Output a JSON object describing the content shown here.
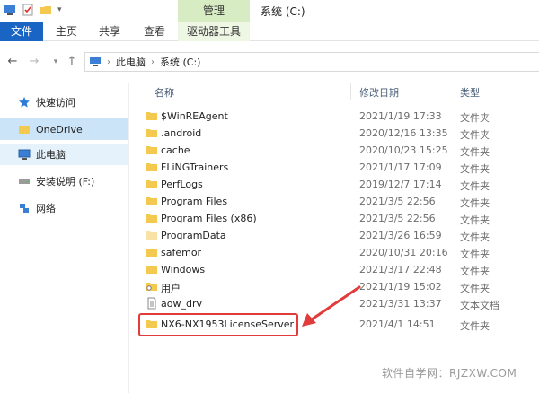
{
  "title_bar": {
    "tool_tab": "管理",
    "window_title": "系统 (C:)"
  },
  "ribbon": {
    "file": "文件",
    "home": "主页",
    "share": "共享",
    "view": "查看",
    "drive_tools": "驱动器工具"
  },
  "address": {
    "path": [
      "此电脑",
      "系统 (C:)"
    ]
  },
  "nav_pane": [
    {
      "label": "快速访问",
      "icon": "star-icon"
    },
    {
      "label": "OneDrive",
      "icon": "cloud-icon"
    },
    {
      "label": "此电脑",
      "icon": "computer-icon"
    },
    {
      "label": "安装说明 (F:)",
      "icon": "drive-icon"
    },
    {
      "label": "网络",
      "icon": "network-icon"
    }
  ],
  "columns": {
    "name": "名称",
    "date": "修改日期",
    "type": "类型"
  },
  "files": [
    {
      "name": "$WinREAgent",
      "date": "2021/1/19 17:33",
      "type": "文件夹",
      "icon": "folder-icon"
    },
    {
      "name": ".android",
      "date": "2020/12/16 13:35",
      "type": "文件夹",
      "icon": "folder-icon"
    },
    {
      "name": "cache",
      "date": "2020/10/23 15:25",
      "type": "文件夹",
      "icon": "folder-icon"
    },
    {
      "name": "FLiNGTrainers",
      "date": "2021/1/17 17:09",
      "type": "文件夹",
      "icon": "folder-icon"
    },
    {
      "name": "PerfLogs",
      "date": "2019/12/7 17:14",
      "type": "文件夹",
      "icon": "folder-icon"
    },
    {
      "name": "Program Files",
      "date": "2021/3/5 22:56",
      "type": "文件夹",
      "icon": "folder-icon"
    },
    {
      "name": "Program Files (x86)",
      "date": "2021/3/5 22:56",
      "type": "文件夹",
      "icon": "folder-icon"
    },
    {
      "name": "ProgramData",
      "date": "2021/3/26 16:59",
      "type": "文件夹",
      "icon": "folder-light-icon"
    },
    {
      "name": "safemor",
      "date": "2020/10/31 20:16",
      "type": "文件夹",
      "icon": "folder-icon"
    },
    {
      "name": "Windows",
      "date": "2021/3/17 22:48",
      "type": "文件夹",
      "icon": "folder-icon"
    },
    {
      "name": "用户",
      "date": "2021/1/19 15:02",
      "type": "文件夹",
      "icon": "user-folder-icon"
    },
    {
      "name": "aow_drv",
      "date": "2021/3/31 13:37",
      "type": "文本文档",
      "icon": "text-file-icon"
    },
    {
      "name": "NX6-NX1953LicenseServer",
      "date": "2021/4/1 14:51",
      "type": "文件夹",
      "icon": "folder-icon"
    }
  ],
  "watermark": "软件自学网：RJZXW.COM",
  "colors": {
    "file_tab": "#1a65c4",
    "manage_tab": "#d7ecc2",
    "selection": "#cce4f7",
    "annotation": "#e23b3b",
    "folder": "#f3c94f"
  }
}
